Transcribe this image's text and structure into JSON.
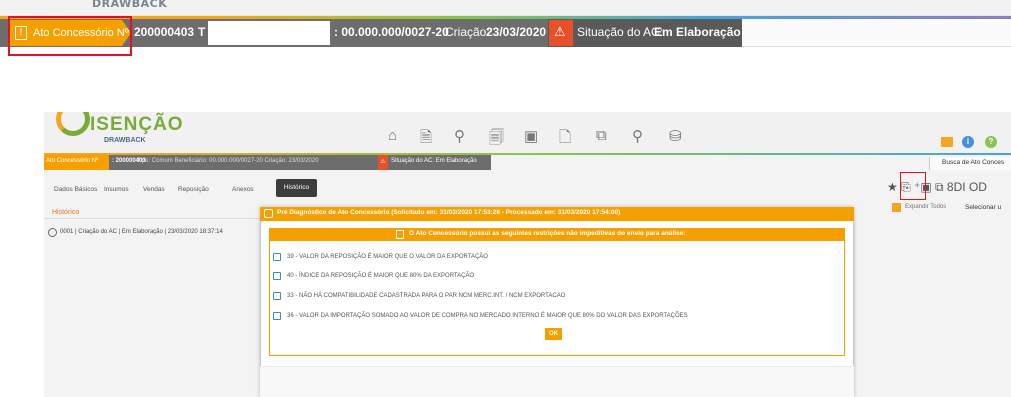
{
  "zoom_bar": {
    "logo_text": "DRAWBACK",
    "ac_label": "Ato Concessório Nº",
    "ac_number": "200000403",
    "t_letter": "T",
    "cnpj": ": 00.000.000/0027-20",
    "criacao_label": "Criação:",
    "criacao_value": "23/03/2020",
    "situacao_label": "Situação do AC:",
    "situacao_value": "Em Elaboração",
    "doc_icon": "!",
    "warn_icon": "⚠"
  },
  "app": {
    "logo": "ISENÇÃO",
    "logo_sub": "DRAWBACK",
    "nav_icons": [
      "⌂",
      "🗎",
      "⚲",
      "🗐",
      "▣",
      "🗋",
      "⧉",
      "⚲",
      "⛁"
    ],
    "header_info_icon": "i",
    "header_help_icon": "?",
    "status_bar": {
      "ac_label": "Ato Concessório Nº",
      "ac_number": ": 200000403",
      "tipo": "Tipo: Comum  Beneficiário: 00.000.000/0027-20  Criação: 23/03/2020",
      "warn_icon": "⚠",
      "situacao": "Situação do AC: Em Elaboração",
      "busca": "Busca de Ato Conces"
    },
    "tabs": [
      "Dados Básicos",
      "Insumos",
      "Vendas",
      "Reposição",
      "Anexos",
      "Histórico"
    ],
    "toolbar_icons": "★ ⎘ ⁺▣ ⧉ 8DI OD",
    "historico": {
      "title": "Histórico",
      "item": "0001 | Criação do AC | Em Elaboração | 23/03/2020 18:37:14"
    },
    "expand_label": "Expandir Todos",
    "select_label": "Selecionar u",
    "modal": {
      "title": "Pré Diagnóstico de Ato Concessório (Solicitado em: 31/03/2020 17:53:26 - Processado em: 31/03/2020 17:54:00)",
      "subtitle": "O Ato Concessório possui as seguintes restrições não impeditivas do envio para análise:",
      "messages": [
        "39 - VALOR DA REPOSIÇÃO É MAIOR QUE O VALOR DA EXPORTAÇÃO",
        "40 - ÍNDICE DA REPOSIÇÃO É MAIOR QUE 80% DA EXPORTAÇÃO",
        "33 - NÃO HÁ COMPATIBILIDADE CADASTRADA PARA O PAR NCM MERC.INT. / NCM EXPORTACAO",
        "36 - VALOR DA IMPORTAÇÃO SOMADO AO VALOR DE COMPRA NO MERCADO INTERNO É MAIOR QUE 80% DO VALOR DAS EXPORTAÇÕES"
      ],
      "ok_label": "OK"
    }
  },
  "colors": {
    "orange": "#f5a000",
    "gray_bar": "#6d6d6d",
    "red_highlight": "#e0141e",
    "warn": "#e8502a"
  }
}
